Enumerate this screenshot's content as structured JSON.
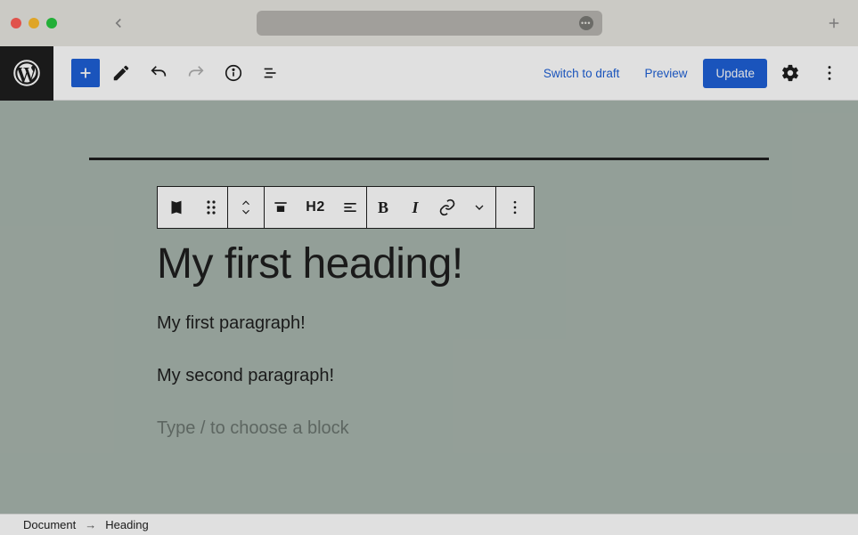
{
  "header": {
    "switch_to_draft": "Switch to draft",
    "preview": "Preview",
    "update": "Update"
  },
  "block_toolbar": {
    "heading_level": "H2"
  },
  "content": {
    "heading": "My first heading!",
    "paragraphs": [
      "My first paragraph!",
      "My second paragraph!"
    ],
    "placeholder": "Type / to choose a block"
  },
  "breadcrumb": {
    "root": "Document",
    "current": "Heading"
  },
  "colors": {
    "accent": "#1e60d6",
    "canvas_bg": "#a8b5ad"
  }
}
